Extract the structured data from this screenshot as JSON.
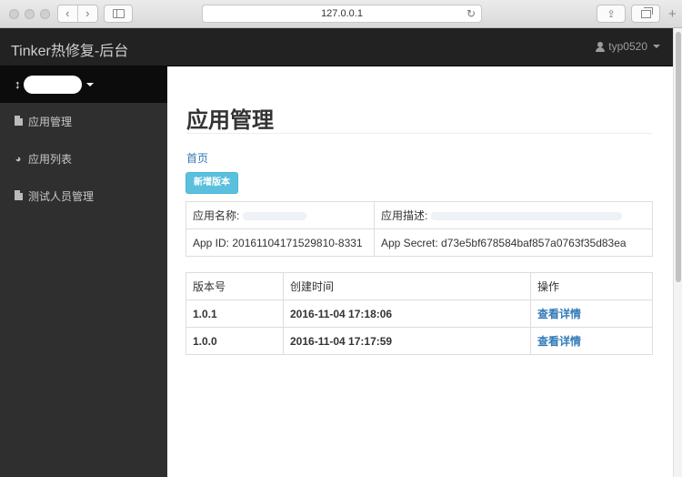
{
  "browser": {
    "url": "127.0.0.1",
    "back_glyph": "‹",
    "forward_glyph": "›",
    "reload_glyph": "↻",
    "share_glyph": "⇪",
    "new_tab_glyph": "+"
  },
  "navbar": {
    "brand": "Tinker热修复-后台",
    "username": "typ0520"
  },
  "sidebar": {
    "switcher_icon": "↕",
    "items": [
      {
        "label": "应用管理",
        "icon": "file-icon"
      },
      {
        "label": "应用列表",
        "icon": "dashboard-icon",
        "glyph": "◕"
      },
      {
        "label": "测试人员管理",
        "icon": "file-icon"
      }
    ]
  },
  "main": {
    "title": "应用管理",
    "breadcrumb": "首页",
    "new_version_button": "新增版本",
    "info": {
      "app_name_label": "应用名称:",
      "app_desc_label": "应用描述:",
      "app_id": "App ID: 20161104171529810-8331",
      "app_secret": "App Secret: d73e5bf678584baf857a0763f35d83ea"
    },
    "versions": {
      "headers": [
        "版本号",
        "创建时间",
        "操作"
      ],
      "rows": [
        {
          "version": "1.0.1",
          "created": "2016-11-04 17:18:06",
          "action": "查看详情"
        },
        {
          "version": "1.0.0",
          "created": "2016-11-04 17:17:59",
          "action": "查看详情"
        }
      ]
    }
  },
  "colors": {
    "navbar_bg": "#222222",
    "sidebar_bg": "#2f2f2f",
    "info_button": "#5bc0de",
    "link": "#337ab7"
  }
}
